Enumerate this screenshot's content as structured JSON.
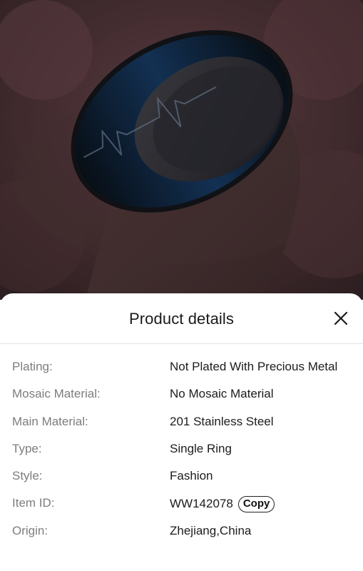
{
  "sheet": {
    "title": "Product details",
    "close_icon": "close-x-icon"
  },
  "details": [
    {
      "label": "Plating:",
      "value": "Not Plated With Precious Metal"
    },
    {
      "label": "Mosaic Material:",
      "value": "No Mosaic Material"
    },
    {
      "label": "Main Material:",
      "value": "201 Stainless Steel"
    },
    {
      "label": "Type:",
      "value": "Single Ring"
    },
    {
      "label": "Style:",
      "value": "Fashion"
    },
    {
      "label": "Item ID:",
      "value": "WW142078",
      "action": "Copy"
    },
    {
      "label": "Origin:",
      "value": "Zhejiang,China"
    }
  ],
  "photo": {
    "subject": "ring-photo",
    "accent": "#2c6fc4"
  }
}
